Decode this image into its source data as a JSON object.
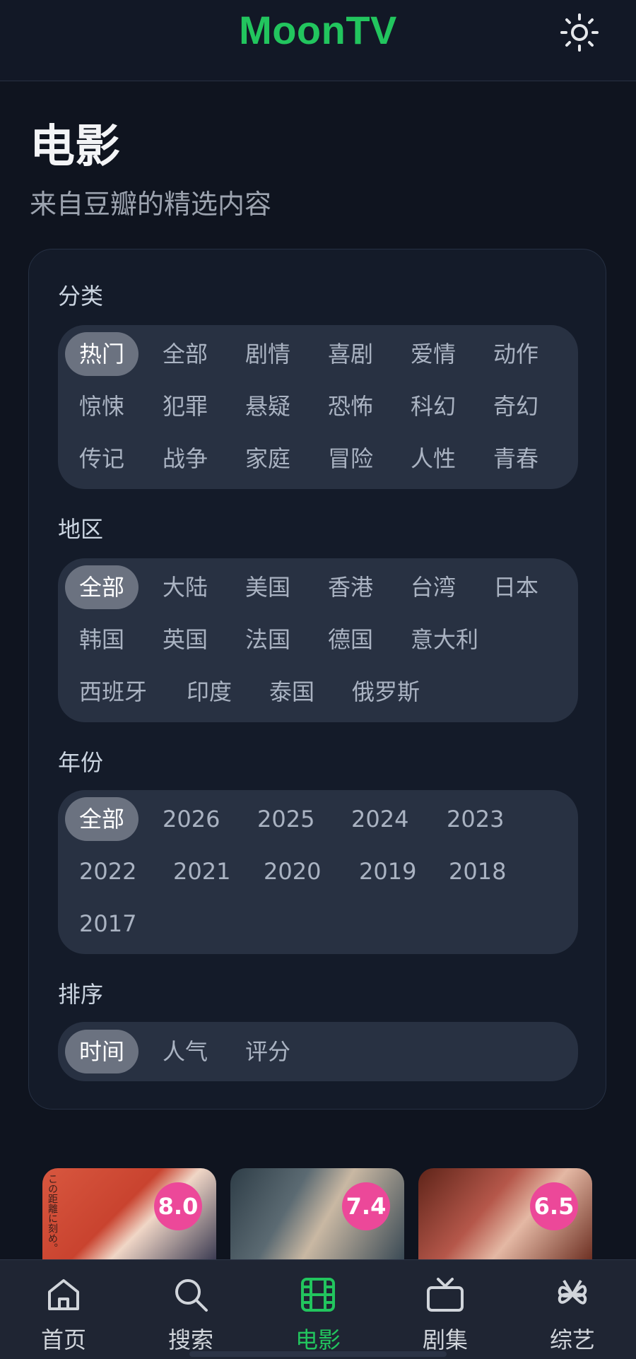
{
  "header": {
    "title": "MoonTV"
  },
  "page": {
    "title": "电影",
    "subtitle": "来自豆瓣的精选内容"
  },
  "filters": {
    "category": {
      "label": "分类",
      "options": [
        "热门",
        "全部",
        "剧情",
        "喜剧",
        "爱情",
        "动作",
        "惊悚",
        "犯罪",
        "悬疑",
        "恐怖",
        "科幻",
        "奇幻",
        "传记",
        "战争",
        "家庭",
        "冒险",
        "人性",
        "青春"
      ],
      "selected": "热门"
    },
    "region": {
      "label": "地区",
      "options": [
        "全部",
        "大陆",
        "美国",
        "香港",
        "台湾",
        "日本",
        "韩国",
        "英国",
        "法国",
        "德国",
        "意大利",
        "西班牙",
        "印度",
        "泰国",
        "俄罗斯"
      ],
      "selected": "全部"
    },
    "year": {
      "label": "年份",
      "options": [
        "全部",
        "2026",
        "2025",
        "2024",
        "2023",
        "2022",
        "2021",
        "2020",
        "2019",
        "2018",
        "2017"
      ],
      "selected": "全部"
    },
    "sort": {
      "label": "排序",
      "options": [
        "时间",
        "人气",
        "评分"
      ],
      "selected": "时间"
    }
  },
  "posters": [
    {
      "rating": "8.0",
      "poster_text": "この距離に刻め。"
    },
    {
      "rating": "7.4"
    },
    {
      "rating": "6.5"
    }
  ],
  "bottom_nav": [
    {
      "label": "首页",
      "icon": "home-icon"
    },
    {
      "label": "搜索",
      "icon": "search-icon"
    },
    {
      "label": "电影",
      "icon": "film-icon",
      "active": true
    },
    {
      "label": "剧集",
      "icon": "tv-icon"
    },
    {
      "label": "综艺",
      "icon": "clover-icon"
    }
  ],
  "colors": {
    "accent": "#22c55e",
    "rating_badge": "#ec4899",
    "background": "#0f141f"
  }
}
